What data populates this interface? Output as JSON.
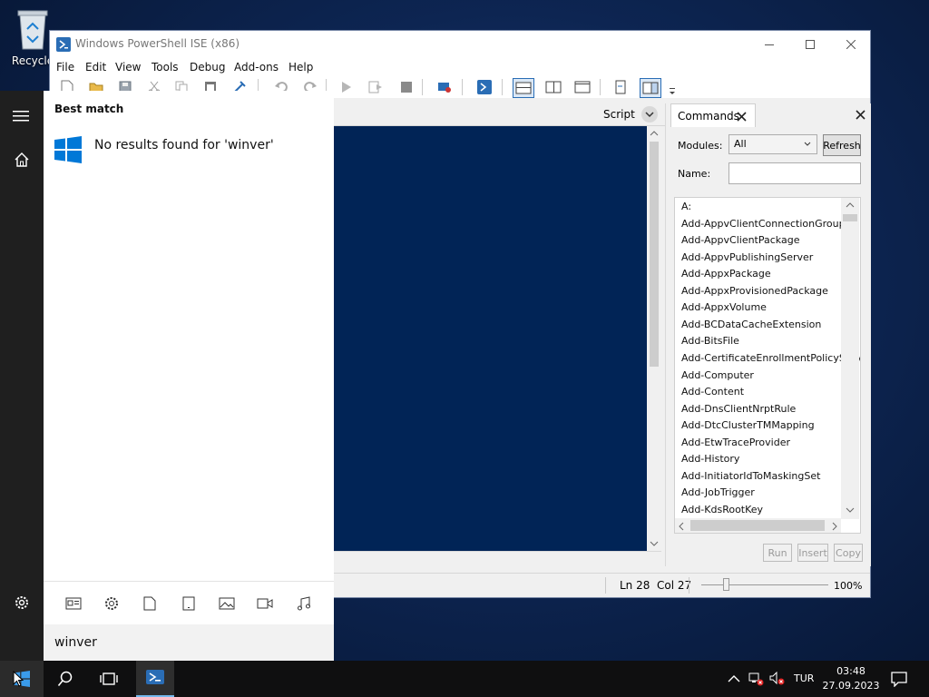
{
  "desktop": {
    "recycle_label": "Recycle"
  },
  "window": {
    "title": "Windows PowerShell ISE (x86)",
    "menus": [
      "File",
      "Edit",
      "View",
      "Tools",
      "Debug",
      "Add-ons",
      "Help"
    ],
    "script_label": "Script",
    "status": {
      "position": "Ln 28  Col 27",
      "zoom": "100%"
    }
  },
  "commands_pane": {
    "tab_label": "Commands",
    "modules_label": "Modules:",
    "modules_value": "All",
    "refresh_label": "Refresh",
    "name_label": "Name:",
    "name_value": "",
    "items": [
      "A:",
      "Add-AppvClientConnectionGroup",
      "Add-AppvClientPackage",
      "Add-AppvPublishingServer",
      "Add-AppxPackage",
      "Add-AppxProvisionedPackage",
      "Add-AppxVolume",
      "Add-BCDataCacheExtension",
      "Add-BitsFile",
      "Add-CertificateEnrollmentPolicyServe",
      "Add-Computer",
      "Add-Content",
      "Add-DnsClientNrptRule",
      "Add-DtcClusterTMMapping",
      "Add-EtwTraceProvider",
      "Add-History",
      "Add-InitiatorIdToMaskingSet",
      "Add-JobTrigger",
      "Add-KdsRootKey"
    ],
    "run_label": "Run",
    "insert_label": "Insert",
    "copy_label": "Copy"
  },
  "start_menu": {
    "best_match": "Best match",
    "no_results": "No results found for 'winver'",
    "query": "winver"
  },
  "taskbar": {
    "language": "TUR",
    "time": "03:48",
    "date": "27.09.2023"
  },
  "colors": {
    "console_bg": "#012456",
    "accent": "#0078d7",
    "taskbar": "#0f0f10"
  }
}
